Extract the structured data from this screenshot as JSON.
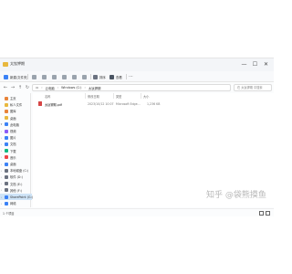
{
  "window": {
    "title": "太钛钾期",
    "controls": [
      "—",
      "☐",
      "✕"
    ]
  },
  "ribbon": {
    "new_label": "新建(文件夹)",
    "cut_label": "",
    "sort_label": "排序",
    "view_label": "查看",
    "more_label": "···"
  },
  "address": {
    "crumbs": [
      "云电脑",
      "Windows (C:)",
      "太钛钾期"
    ],
    "search_placeholder": "在 太钛钾期 中搜索"
  },
  "sidebar": {
    "items": [
      {
        "label": "主页",
        "icon": "home-icon",
        "color": "#e8843a",
        "chev": ""
      },
      {
        "label": "私人文件",
        "icon": "folder-icon",
        "color": "#e8b83e",
        "chev": ""
      },
      {
        "label": "图库",
        "icon": "gallery-icon",
        "color": "#e8843a",
        "chev": ""
      },
      {
        "label": "桌面",
        "icon": "folder-icon",
        "color": "#e8b83e",
        "chev": ""
      },
      {
        "label": "此电脑",
        "icon": "pc-icon",
        "color": "#3b82f6",
        "chev": "▾"
      },
      {
        "label": "视频",
        "icon": "video-icon",
        "color": "#8b5cf6",
        "chev": "›"
      },
      {
        "label": "图片",
        "icon": "pictures-icon",
        "color": "#3b82f6",
        "chev": "›"
      },
      {
        "label": "文档",
        "icon": "documents-icon",
        "color": "#3b82f6",
        "chev": "›"
      },
      {
        "label": "下载",
        "icon": "downloads-icon",
        "color": "#10b981",
        "chev": "›"
      },
      {
        "label": "音乐",
        "icon": "music-icon",
        "color": "#ef4444",
        "chev": "›"
      },
      {
        "label": "桌面",
        "icon": "desktop-icon",
        "color": "#3b82f6",
        "chev": "›"
      },
      {
        "label": "本地磁盘 (C:)",
        "icon": "drive-icon",
        "color": "#6b7280",
        "chev": "›"
      },
      {
        "label": "软件 (D:)",
        "icon": "drive-icon",
        "color": "#6b7280",
        "chev": "›"
      },
      {
        "label": "文档 (E:)",
        "icon": "drive-icon",
        "color": "#6b7280",
        "chev": "›"
      },
      {
        "label": "其他 (F:)",
        "icon": "drive-icon",
        "color": "#6b7280",
        "chev": "›"
      },
      {
        "label": "SharePoint (G:)",
        "icon": "drive-icon",
        "color": "#3b82f6",
        "chev": "›"
      },
      {
        "label": "网络",
        "icon": "network-icon",
        "color": "#3b82f6",
        "chev": "›"
      }
    ],
    "selected_index": 15
  },
  "content": {
    "columns": [
      "名称",
      "修改日期",
      "类型",
      "大小"
    ],
    "files": [
      {
        "name": "太钛钾期.pdf",
        "modified": "2023/10/12 10:07",
        "type": "Microsoft Edge...",
        "size": "1,236 KB",
        "icon": "pdf-icon"
      }
    ]
  },
  "statusbar": {
    "text": "1 个项目"
  },
  "watermark": {
    "text": "知乎 @袋熊摸鱼"
  }
}
